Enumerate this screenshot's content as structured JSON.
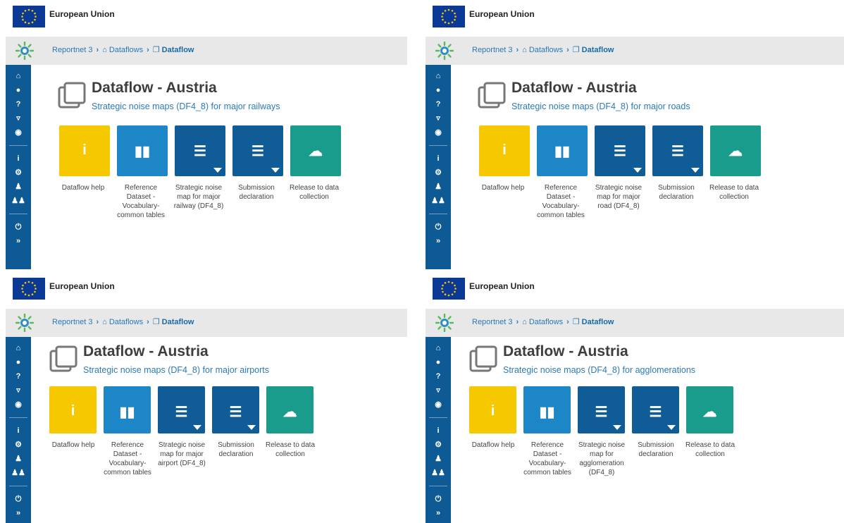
{
  "eu_label": "European Union",
  "breadcrumb": {
    "root": "Reportnet 3",
    "dataflows": "Dataflows",
    "current": "Dataflow"
  },
  "icons": {
    "sidebar": [
      "home-icon",
      "user-icon",
      "help-icon",
      "bell-icon",
      "chat-icon",
      "info-icon",
      "gear-icon",
      "user-settings-icon",
      "users-icon",
      "power-icon",
      "expand-icon"
    ]
  },
  "colors": {
    "yellow": "#f6c800",
    "blue": "#1c86c7",
    "dark_blue": "#0f5c96",
    "teal": "#1a9c8c",
    "sidebar": "#0d5a94"
  },
  "panels": [
    {
      "title": "Dataflow - Austria",
      "subtitle": "Strategic noise maps (DF4_8) for major railways",
      "tiles": [
        {
          "label": "Dataflow help"
        },
        {
          "label": "Reference Dataset - Vocabulary-common tables"
        },
        {
          "label": "Strategic noise map for major railway (DF4_8)"
        },
        {
          "label": "Submission declaration"
        },
        {
          "label": "Release to data collection"
        }
      ]
    },
    {
      "title": "Dataflow - Austria",
      "subtitle": "Strategic noise maps (DF4_8) for major roads",
      "tiles": [
        {
          "label": "Dataflow help"
        },
        {
          "label": "Reference Dataset - Vocabulary-common tables"
        },
        {
          "label": "Strategic noise map for major road (DF4_8)"
        },
        {
          "label": "Submission declaration"
        },
        {
          "label": "Release to data collection"
        }
      ]
    },
    {
      "title": "Dataflow - Austria",
      "subtitle": "Strategic noise maps (DF4_8) for major airports",
      "tiles": [
        {
          "label": "Dataflow help"
        },
        {
          "label": "Reference Dataset - Vocabulary-common tables"
        },
        {
          "label": "Strategic noise map for major airport (DF4_8)"
        },
        {
          "label": "Submission declaration"
        },
        {
          "label": "Release to data collection"
        }
      ]
    },
    {
      "title": "Dataflow - Austria",
      "subtitle": "Strategic noise maps (DF4_8) for agglomerations",
      "tiles": [
        {
          "label": "Dataflow help"
        },
        {
          "label": "Reference Dataset - Vocabulary-common tables"
        },
        {
          "label": "Strategic noise map for agglomeration (DF4_8)"
        },
        {
          "label": "Submission declaration"
        },
        {
          "label": "Release to data collection"
        }
      ]
    }
  ]
}
